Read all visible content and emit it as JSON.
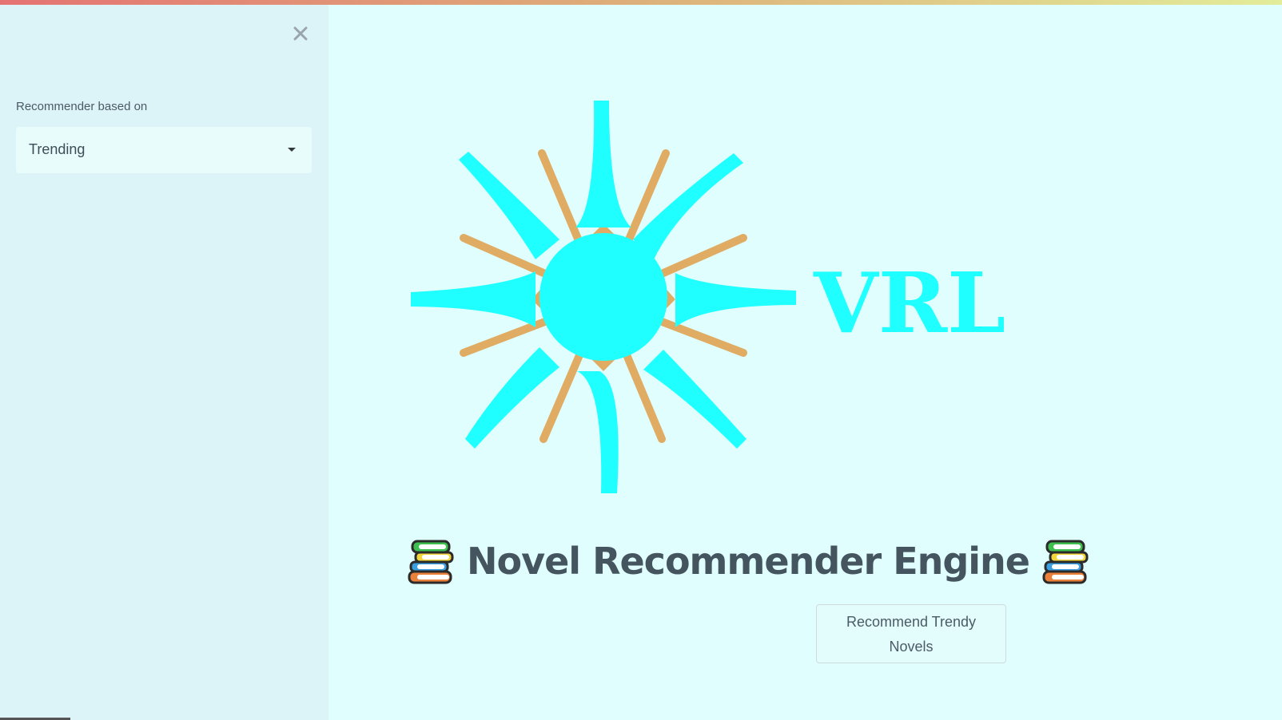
{
  "sidebar": {
    "close_icon": "close-icon",
    "select_label": "Recommender based on",
    "select_value": "Trending",
    "select_icon": "caret-down-icon"
  },
  "logo": {
    "text": "VRL",
    "primary_color": "#1fffff",
    "accent_color": "#e0ac63"
  },
  "main": {
    "title": "Novel Recommender Engine",
    "title_icon": "books-icon",
    "button_line1": "Recommend Trendy",
    "button_line2": "Novels"
  },
  "colors": {
    "background": "#e0fefe",
    "sidebar": "#dcf4f7",
    "text": "#44555f"
  }
}
